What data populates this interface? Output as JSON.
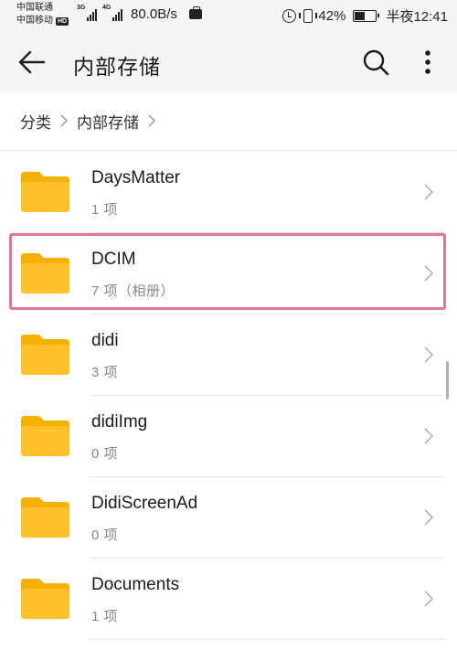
{
  "status_bar": {
    "carrier1": "中国联通",
    "carrier2": "中国移动",
    "hd_badge": "HD",
    "net1": "3G",
    "net2": "4G",
    "speed": "80.0B/s",
    "battery": "42%",
    "battery_level": 0.42,
    "time": "半夜12:41",
    "icons": [
      "alarm-icon",
      "vibrate-icon",
      "battery-icon",
      "briefcase-icon"
    ]
  },
  "header": {
    "title": "内部存储",
    "icons": [
      "back-arrow-icon",
      "search-icon",
      "more-vert-icon"
    ]
  },
  "breadcrumb": {
    "items": [
      "分类",
      "内部存储"
    ]
  },
  "folders": [
    {
      "name": "DaysMatter",
      "meta": "1 项"
    },
    {
      "name": "DCIM",
      "meta": "7 项（相册）"
    },
    {
      "name": "didi",
      "meta": "3 项"
    },
    {
      "name": "didiImg",
      "meta": "0 项"
    },
    {
      "name": "DidiScreenAd",
      "meta": "0 项"
    },
    {
      "name": "Documents",
      "meta": "1 项"
    }
  ],
  "colors": {
    "folder": "#ffc12a",
    "folder_tab": "#f5b000",
    "highlight": "#e9729b",
    "header_bg": "#f5f5f5"
  }
}
